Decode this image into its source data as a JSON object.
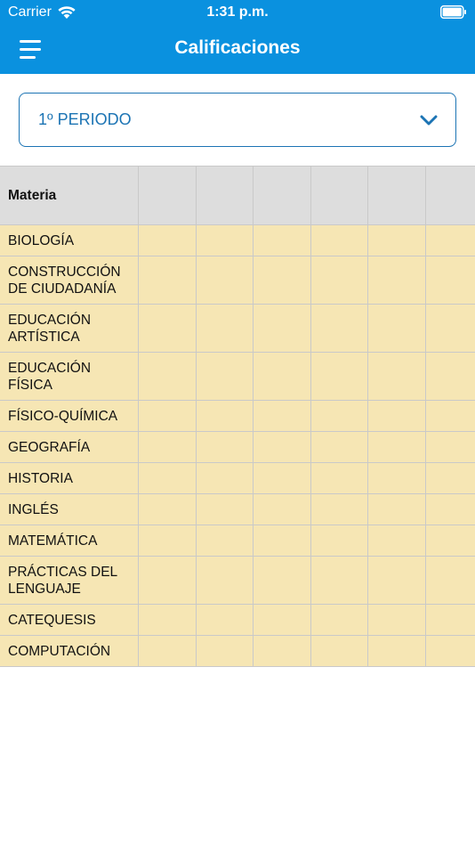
{
  "status_bar": {
    "carrier": "Carrier",
    "time": "1:31 p.m."
  },
  "navbar": {
    "title": "Calificaciones",
    "background_color": "#0a91df"
  },
  "period_selector": {
    "selected": "1º PERIODO",
    "accent_color": "#1c74b4"
  },
  "table": {
    "header_subject": "Materia",
    "header_bg": "#dddddd",
    "row_bg": "#f6e6b4",
    "subjects": [
      "BIOLOGÍA",
      "CONSTRUCCIÓN DE CIUDADANÍA",
      "EDUCACIÓN ARTÍSTICA",
      "EDUCACIÓN FÍSICA",
      "FÍSICO-QUÍMICA",
      "GEOGRAFÍA",
      "HISTORIA",
      "INGLÉS",
      "MATEMÁTICA",
      "PRÁCTICAS DEL LENGUAJE",
      "CATEQUESIS",
      "COMPUTACIÓN"
    ]
  }
}
